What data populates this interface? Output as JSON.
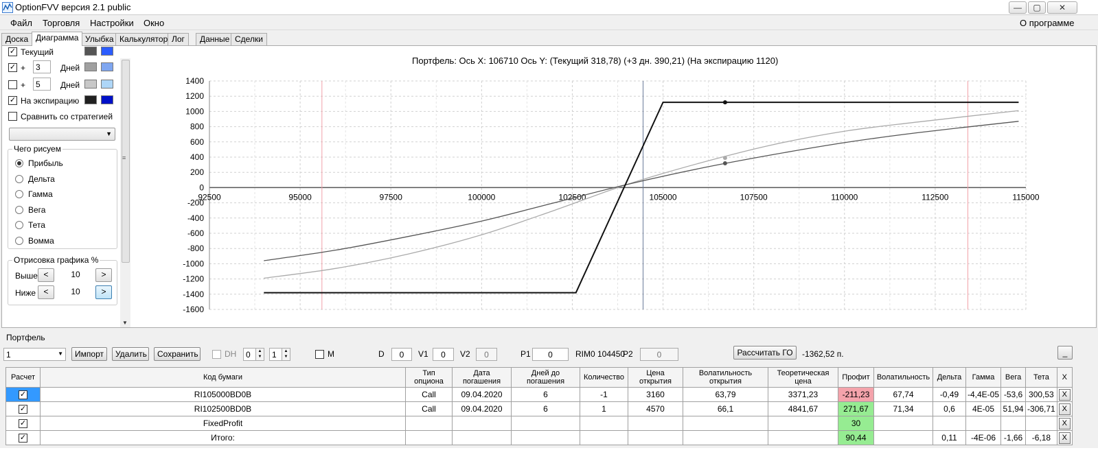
{
  "window": {
    "title": "OptionFVV версия 2.1 public",
    "minimize": "—",
    "maximize": "▢",
    "close": "✕"
  },
  "menu": {
    "items": [
      "Файл",
      "Торговля",
      "Настройки",
      "Окно"
    ],
    "about": "О программе"
  },
  "tabs": [
    "Доска",
    "Диаграмма",
    "Улыбка",
    "Калькулятор",
    "Лог",
    "Данные",
    "Сделки"
  ],
  "active_tab": "Диаграмма",
  "left": {
    "current_label": "Текущий",
    "plus": "+",
    "days_label": "Дней",
    "days1": "3",
    "days2": "5",
    "expiry_label": "На экспирацию",
    "compare_label": "Сравнить со стратегией",
    "what_title": "Чего рисуем",
    "what_options": [
      "Прибыль",
      "Дельта",
      "Гамма",
      "Вега",
      "Тета",
      "Вомма"
    ],
    "draw_title": "Отрисовка графика %",
    "above_label": "Выше",
    "below_label": "Ниже",
    "above_value": "10",
    "below_value": "10",
    "left_arrow": "<",
    "right_arrow": ">",
    "colors": {
      "current_a": "#555555",
      "current_b": "#2b5cff",
      "days1_a": "#a0a0a0",
      "days1_b": "#7fa6f0",
      "days2_a": "#c8c8c8",
      "days2_b": "#aed6f7",
      "expiry_a": "#202020",
      "expiry_b": "#0010c8"
    }
  },
  "chart_title": "Портфель: Ось X: 106710 Ось Y:  (Текущий 318,78)  (+3 дн. 390,21)  (На экспирацию 1120)",
  "chart_data": {
    "type": "line",
    "x_ticks": [
      "92500",
      "95000",
      "97500",
      "100000",
      "102500",
      "105000",
      "107500",
      "110000",
      "112500",
      "115000"
    ],
    "y_ticks": [
      "1400",
      "1200",
      "1000",
      "800",
      "600",
      "400",
      "200",
      "0",
      "-200",
      "-400",
      "-600",
      "-800",
      "-1000",
      "-1200",
      "-1400",
      "-1600"
    ],
    "xlim": [
      92500,
      115000
    ],
    "ylim": [
      -1600,
      1400
    ],
    "grid": true,
    "cursor_x": 106710,
    "current_price_x": 104450,
    "red_lines_x": [
      95600,
      113400
    ],
    "series": [
      {
        "color": "#111111",
        "width": 2,
        "x": [
          94000,
          102600,
          105000,
          114800
        ],
        "y": [
          -1380,
          -1380,
          1120,
          1120
        ],
        "marker": {
          "x": 106710,
          "y": 1120
        }
      },
      {
        "color": "#555555",
        "width": 1.3,
        "x": [
          94000,
          96000,
          98000,
          100000,
          102000,
          104000,
          106000,
          108000,
          110000,
          112000,
          114800
        ],
        "y": [
          -960,
          -820,
          -640,
          -440,
          -200,
          40,
          250,
          430,
          590,
          720,
          870
        ],
        "marker": {
          "x": 106710,
          "y": 318.78
        }
      },
      {
        "color": "#aaaaaa",
        "width": 1.3,
        "x": [
          94000,
          96000,
          98000,
          100000,
          102000,
          104000,
          106000,
          108000,
          110000,
          112000,
          114800
        ],
        "y": [
          -1190,
          -1060,
          -870,
          -620,
          -300,
          40,
          320,
          560,
          740,
          860,
          1010
        ],
        "marker": {
          "x": 106710,
          "y": 390.21
        }
      }
    ]
  },
  "portfolio": {
    "label": "Портфель",
    "select_value": "1",
    "import": "Импорт",
    "delete": "Удалить",
    "save": "Сохранить",
    "dh_label": "DH",
    "spin1": "0",
    "spin2": "1",
    "m_label": "M",
    "d_label": "D",
    "d_value": "0",
    "v1_label": "V1",
    "v1_value": "0",
    "v2_label": "V2",
    "v2_value": "0",
    "p1_label": "P1",
    "p1_value": "0",
    "rim_label": "RIM0 104450",
    "p2_label": "P2",
    "p2_value": "0",
    "calc_go": "Рассчитать ГО",
    "go_value": "-1362,52 п.",
    "collapse": "_"
  },
  "table": {
    "headers": [
      "Расчет",
      "Код бумаги",
      "Тип опциона",
      "Дата погашения",
      "Дней до погашения",
      "Количество",
      "Цена открытия",
      "Волатильность открытия",
      "Теоретическая цена",
      "Профит",
      "Волатильность",
      "Дельта",
      "Гамма",
      "Вега",
      "Тета",
      "X"
    ],
    "rows": [
      [
        "✓",
        "RI105000BD0B",
        "Call",
        "09.04.2020",
        "6",
        "-1",
        "3160",
        "63,79",
        "3371,23",
        "-211,23",
        "67,74",
        "-0,49",
        "-4,4E-05",
        "-53,6",
        "300,53",
        "X"
      ],
      [
        "✓",
        "RI102500BD0B",
        "Call",
        "09.04.2020",
        "6",
        "1",
        "4570",
        "66,1",
        "4841,67",
        "271,67",
        "71,34",
        "0,6",
        "4E-05",
        "51,94",
        "-306,71",
        "X"
      ],
      [
        "✓",
        "FixedProfit",
        "",
        "",
        "",
        "",
        "",
        "",
        "",
        "30",
        "",
        "",
        "",
        "",
        "",
        "X"
      ],
      [
        "✓",
        "Итого:",
        "",
        "",
        "",
        "",
        "",
        "",
        "",
        "90,44",
        "",
        "0,11",
        "-4E-06",
        "-1,66",
        "-6,18",
        "X"
      ]
    ],
    "profit_colors": [
      "red",
      "green",
      "green",
      "green"
    ]
  }
}
